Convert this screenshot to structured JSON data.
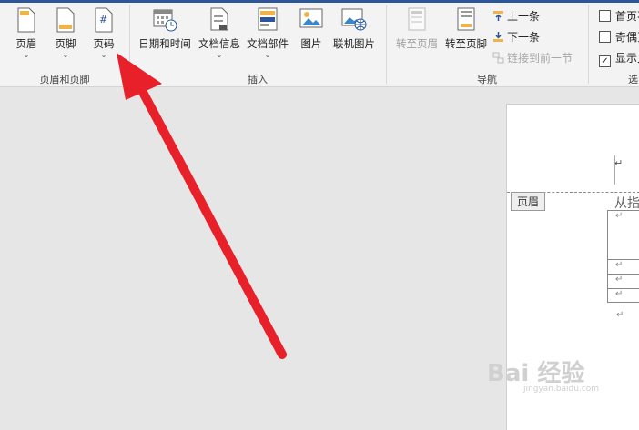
{
  "ribbon": {
    "group_header_footer": {
      "label": "页眉和页脚",
      "header_label": "页眉",
      "footer_label": "页脚",
      "page_number_label": "页码"
    },
    "group_insert": {
      "label": "插入",
      "datetime_label": "日期和时间",
      "docinfo_label": "文档信息",
      "docparts_label": "文档部件",
      "picture_label": "图片",
      "online_picture_label": "联机图片"
    },
    "group_nav": {
      "label": "导航",
      "goto_header_label": "转至页眉",
      "goto_footer_label": "转至页脚",
      "prev_label": "上一条",
      "next_label": "下一条",
      "link_prev_label": "链接到前一节"
    },
    "group_options": {
      "label": "选",
      "first_page_label": "首页不",
      "odd_even_label": "奇偶页",
      "show_text_label": "显示文"
    }
  },
  "document": {
    "header_tag": "页眉",
    "header_text_peek": "从指",
    "paragraph_mark": "↵"
  },
  "watermark": {
    "text": "Bai 经验",
    "sub": "jingyan.baidu.com"
  },
  "colors": {
    "accent": "#2b579a",
    "arrow": "#e8202a"
  }
}
